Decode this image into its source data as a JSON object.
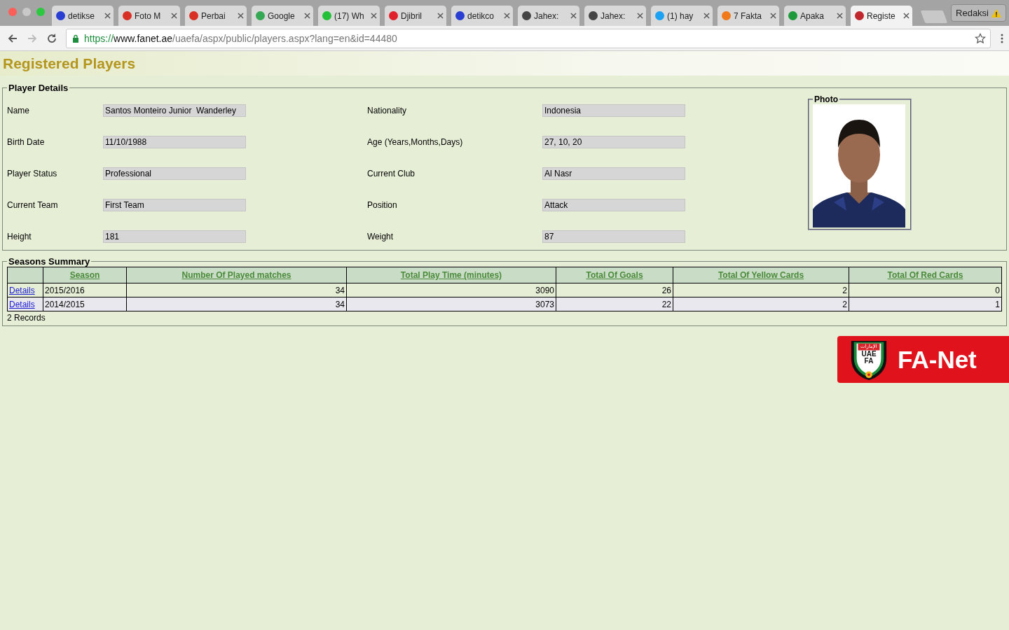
{
  "browser": {
    "tabs": [
      {
        "title": "detikse",
        "color": "#2a3fd1",
        "selected": false
      },
      {
        "title": "Foto M",
        "color": "#d93025",
        "selected": false
      },
      {
        "title": "Perbai",
        "color": "#d93025",
        "selected": false
      },
      {
        "title": "Google",
        "color": "#34a853",
        "selected": false
      },
      {
        "title": "(17) Wh",
        "color": "#25c03a",
        "selected": false
      },
      {
        "title": "Djibril",
        "color": "#e0202a",
        "selected": false
      },
      {
        "title": "detikco",
        "color": "#2a3fd1",
        "selected": false
      },
      {
        "title": "Jahex:",
        "color": "#444444",
        "selected": false
      },
      {
        "title": "Jahex:",
        "color": "#444444",
        "selected": false
      },
      {
        "title": "(1) hay",
        "color": "#1da1f2",
        "selected": false
      },
      {
        "title": "7 Fakta",
        "color": "#f07a1a",
        "selected": false
      },
      {
        "title": "Apaka",
        "color": "#1e9a3c",
        "selected": false
      },
      {
        "title": "Registe",
        "color": "#c0282d",
        "selected": true
      }
    ],
    "profile_button": "Redaksi",
    "url": {
      "scheme": "https://",
      "host": "www.fanet.ae",
      "path": "/uaefa/aspx/public/players.aspx?lang=en&id=44480"
    }
  },
  "page_title": "Registered Players",
  "player_details": {
    "legend": "Player Details",
    "fields": [
      {
        "label": "Name",
        "value": "Santos Monteiro Junior  Wanderley"
      },
      {
        "label": "Nationality",
        "value": "Indonesia"
      },
      {
        "label": "Birth Date",
        "value": "11/10/1988"
      },
      {
        "label": "Age (Years,Months,Days)",
        "value": "27, 10, 20"
      },
      {
        "label": "Player Status",
        "value": "Professional"
      },
      {
        "label": "Current Club",
        "value": "Al Nasr"
      },
      {
        "label": "Current Team",
        "value": "First Team"
      },
      {
        "label": "Position",
        "value": "Attack"
      },
      {
        "label": "Height",
        "value": "181"
      },
      {
        "label": "Weight",
        "value": "87"
      }
    ],
    "photo_legend": "Photo"
  },
  "seasons_summary": {
    "legend": "Seasons Summary",
    "columns": [
      "Season",
      "Number Of Played matches",
      "Total Play Time (minutes)",
      "Total Of Goals",
      "Total Of Yellow Cards",
      "Total Of Red Cards"
    ],
    "rows": [
      {
        "link": "Details",
        "cells": [
          "2015/2016",
          "34",
          "3090",
          "26",
          "2",
          "0"
        ]
      },
      {
        "link": "Details",
        "cells": [
          "2014/2015",
          "34",
          "3073",
          "22",
          "2",
          "1"
        ]
      }
    ],
    "footer": "2 Records"
  },
  "logo": {
    "badge_top": "الإمارات",
    "badge_lines": [
      "UAE",
      "FA"
    ],
    "wordmark": "FA-Net"
  }
}
